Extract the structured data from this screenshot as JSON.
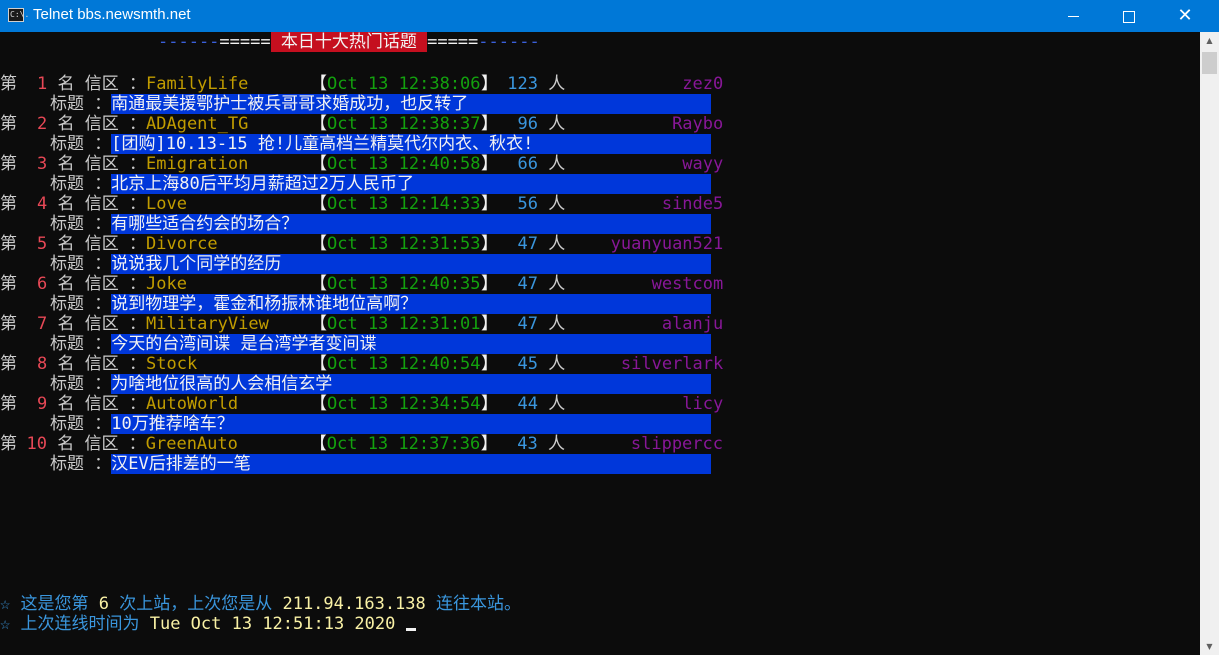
{
  "window": {
    "title": "Telnet bbs.newsmth.net",
    "icon": "console-icon",
    "icon_text": "C:\\."
  },
  "header": {
    "left_dashes": "------",
    "left_eq": "=====",
    "title": " 本日十大热门话题 ",
    "right_eq": "=====",
    "right_dashes": "------"
  },
  "labels": {
    "rank_prefix": "第",
    "rank_suffix": "名",
    "board": "信区",
    "colon": "：",
    "title": "标题",
    "open_bracket": "【",
    "close_bracket": "】",
    "people": "人"
  },
  "topics": [
    {
      "rank": "1",
      "board": "FamilyLife",
      "time": "Oct 13 12:38:06",
      "count": "123",
      "user": "zez0",
      "title": "南通最美援鄂护士被兵哥哥求婚成功，也反转了"
    },
    {
      "rank": "2",
      "board": "ADAgent_TG",
      "time": "Oct 13 12:38:37",
      "count": "96",
      "user": "Raybo",
      "title": "[团购]10.13-15 抢!儿童高档兰精莫代尔内衣、秋衣!"
    },
    {
      "rank": "3",
      "board": "Emigration",
      "time": "Oct 13 12:40:58",
      "count": "66",
      "user": "wayy",
      "title": "北京上海80后平均月薪超过2万人民币了"
    },
    {
      "rank": "4",
      "board": "Love",
      "time": "Oct 13 12:14:33",
      "count": "56",
      "user": "sinde5",
      "title": "有哪些适合约会的场合？"
    },
    {
      "rank": "5",
      "board": "Divorce",
      "time": "Oct 13 12:31:53",
      "count": "47",
      "user": "yuanyuan521",
      "title": "说说我几个同学的经历"
    },
    {
      "rank": "6",
      "board": "Joke",
      "time": "Oct 13 12:40:35",
      "count": "47",
      "user": "westcom",
      "title": "说到物理学，霍金和杨振林谁地位高啊？"
    },
    {
      "rank": "7",
      "board": "MilitaryView",
      "time": "Oct 13 12:31:01",
      "count": "47",
      "user": "alanju",
      "title": "今天的台湾间谍 是台湾学者变间谍"
    },
    {
      "rank": "8",
      "board": "Stock",
      "time": "Oct 13 12:40:54",
      "count": "45",
      "user": "silverlark",
      "title": "为啥地位很高的人会相信玄学"
    },
    {
      "rank": "9",
      "board": "AutoWorld",
      "time": "Oct 13 12:34:54",
      "count": "44",
      "user": "licy",
      "title": "10万推荐啥车？"
    },
    {
      "rank": "10",
      "board": "GreenAuto",
      "time": "Oct 13 12:37:36",
      "count": "43",
      "user": "slippercc",
      "title": "汉EV后排差的一笔"
    }
  ],
  "footer": {
    "star": "☆",
    "line1_a": " 这是您第 ",
    "line1_count": "6",
    "line1_b": " 次上站，上次您是从 ",
    "line1_ip": "211.94.163.138",
    "line1_c": " 连往本站。",
    "line2_a": " 上次连线时间为 ",
    "line2_time": "Tue Oct 13 12:51:13 2020"
  }
}
